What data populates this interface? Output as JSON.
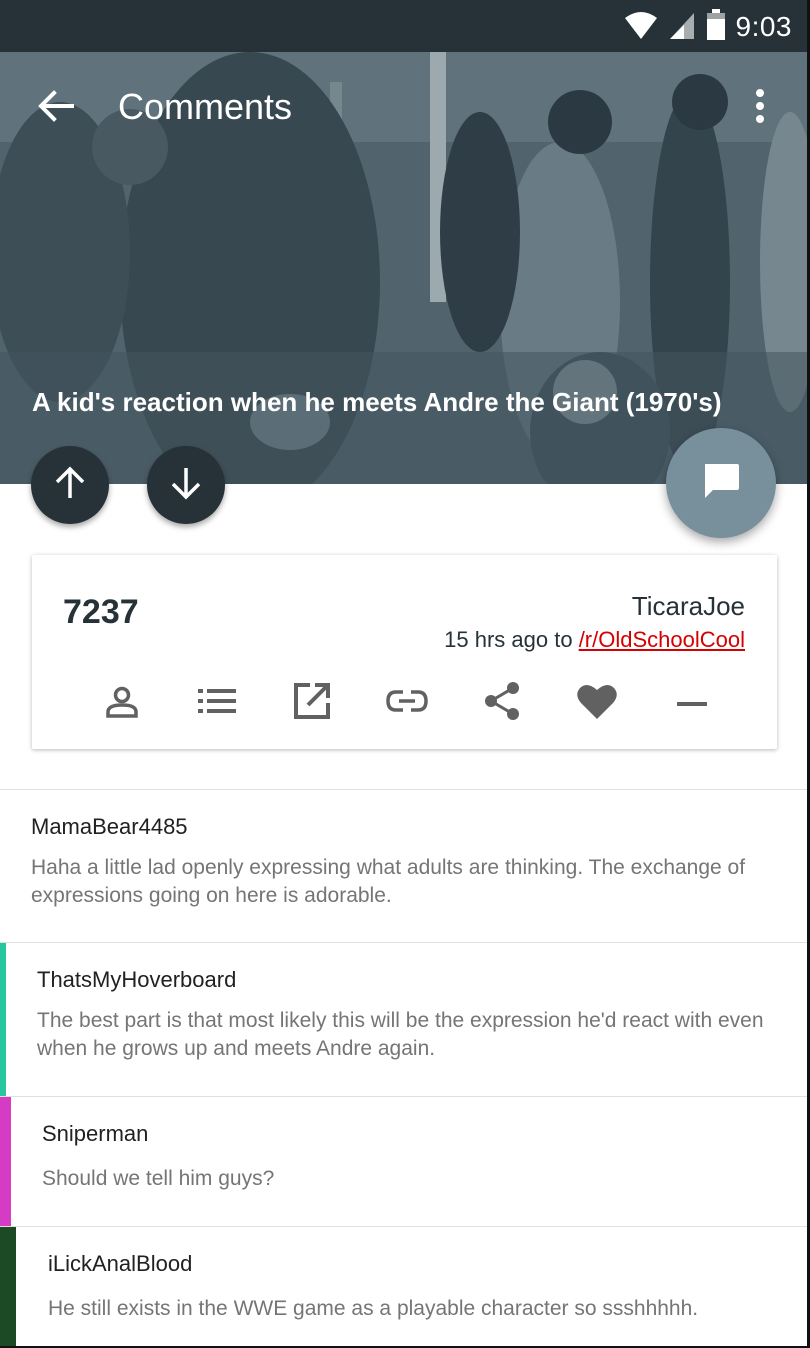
{
  "status_bar": {
    "time": "9:03",
    "icons": [
      "wifi-icon",
      "signal-icon",
      "battery-icon"
    ]
  },
  "toolbar": {
    "title": "Comments",
    "back_icon": "arrow-back-icon",
    "more_icon": "more-vert-icon"
  },
  "post": {
    "title": "A kid's reaction when he meets Andre the Giant (1970's)",
    "score": "7237",
    "author": "TicaraJoe",
    "time_prefix": "15 hrs ago to ",
    "subreddit": "/r/OldSchoolCool"
  },
  "actions": [
    {
      "name": "profile-icon"
    },
    {
      "name": "list-icon"
    },
    {
      "name": "open-external-icon"
    },
    {
      "name": "link-icon"
    },
    {
      "name": "share-icon"
    },
    {
      "name": "heart-icon"
    },
    {
      "name": "minus-icon"
    }
  ],
  "comments": [
    {
      "author": "MamaBear4485",
      "body": "Haha a little lad openly expressing what adults are thinking. The exchange of expressions going on here is adorable.",
      "color": "#ffffff"
    },
    {
      "author": "ThatsMyHoverboard",
      "body": "The best part is that most likely this will be the expression he'd react with even when he grows up and meets Andre again.",
      "color": "#26c6a0"
    },
    {
      "author": "Sniperman",
      "body": "Should we tell him guys?",
      "color": "#d63bc4"
    },
    {
      "author": "iLickAnalBlood",
      "body": "He still exists in the WWE game as a playable character so ssshhhhh.",
      "color": "#1b4a24"
    }
  ],
  "colors": {
    "status_bar": "#263238",
    "vote_button": "#263238",
    "fab": "#78909c",
    "subreddit_link": "#d50000"
  }
}
